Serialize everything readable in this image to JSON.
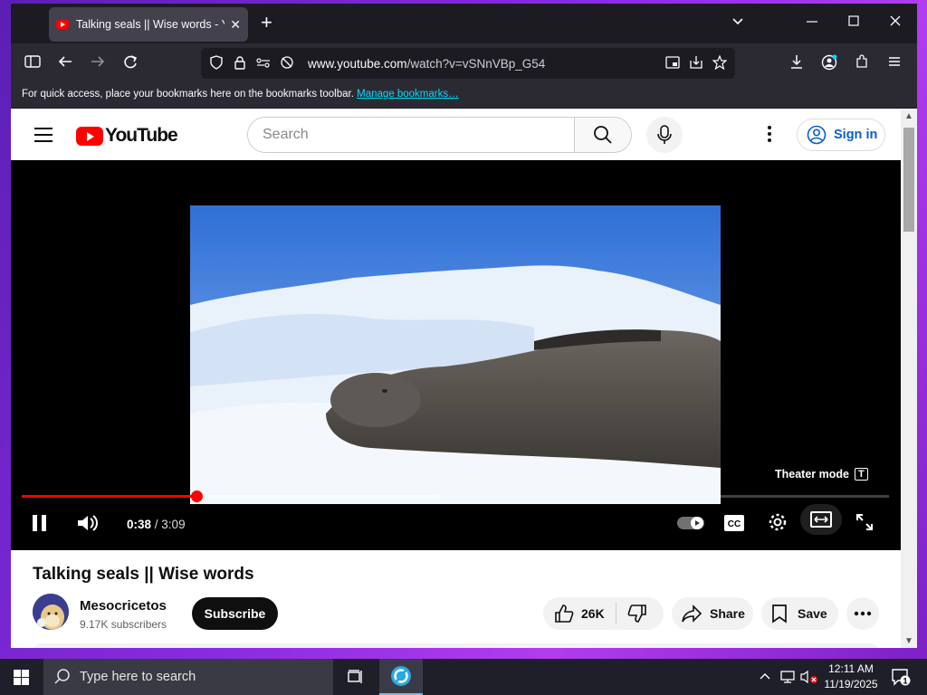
{
  "browser": {
    "tab_title": "Talking seals || Wise words - YouTube",
    "url_host": "www.youtube.com",
    "url_path": "/watch?v=vSNnVBp_G54",
    "bookmarks_text": "For quick access, place your bookmarks here on the bookmarks toolbar.",
    "bookmarks_link": "Manage bookmarks…"
  },
  "youtube": {
    "logo_text": "YouTube",
    "search_placeholder": "Search",
    "sign_in": "Sign in"
  },
  "player": {
    "theater_label": "Theater mode",
    "theater_key": "T",
    "current_time": "0:38",
    "separator": " / ",
    "duration": "3:09",
    "progress_fraction": 0.201,
    "buffered_fraction": 0.48
  },
  "video": {
    "title": "Talking seals || Wise words",
    "channel": "Mesocricetos",
    "subscribers": "9.17K subscribers",
    "subscribe_label": "Subscribe",
    "likes": "26K",
    "share_label": "Share",
    "save_label": "Save"
  },
  "taskbar": {
    "search_placeholder": "Type here to search",
    "time": "12:11 AM",
    "date": "11/19/2025",
    "notification_count": "1"
  },
  "colors": {
    "accent_red": "#ff0000",
    "link_blue": "#065fd4",
    "browser_dark": "#2b2a33"
  }
}
